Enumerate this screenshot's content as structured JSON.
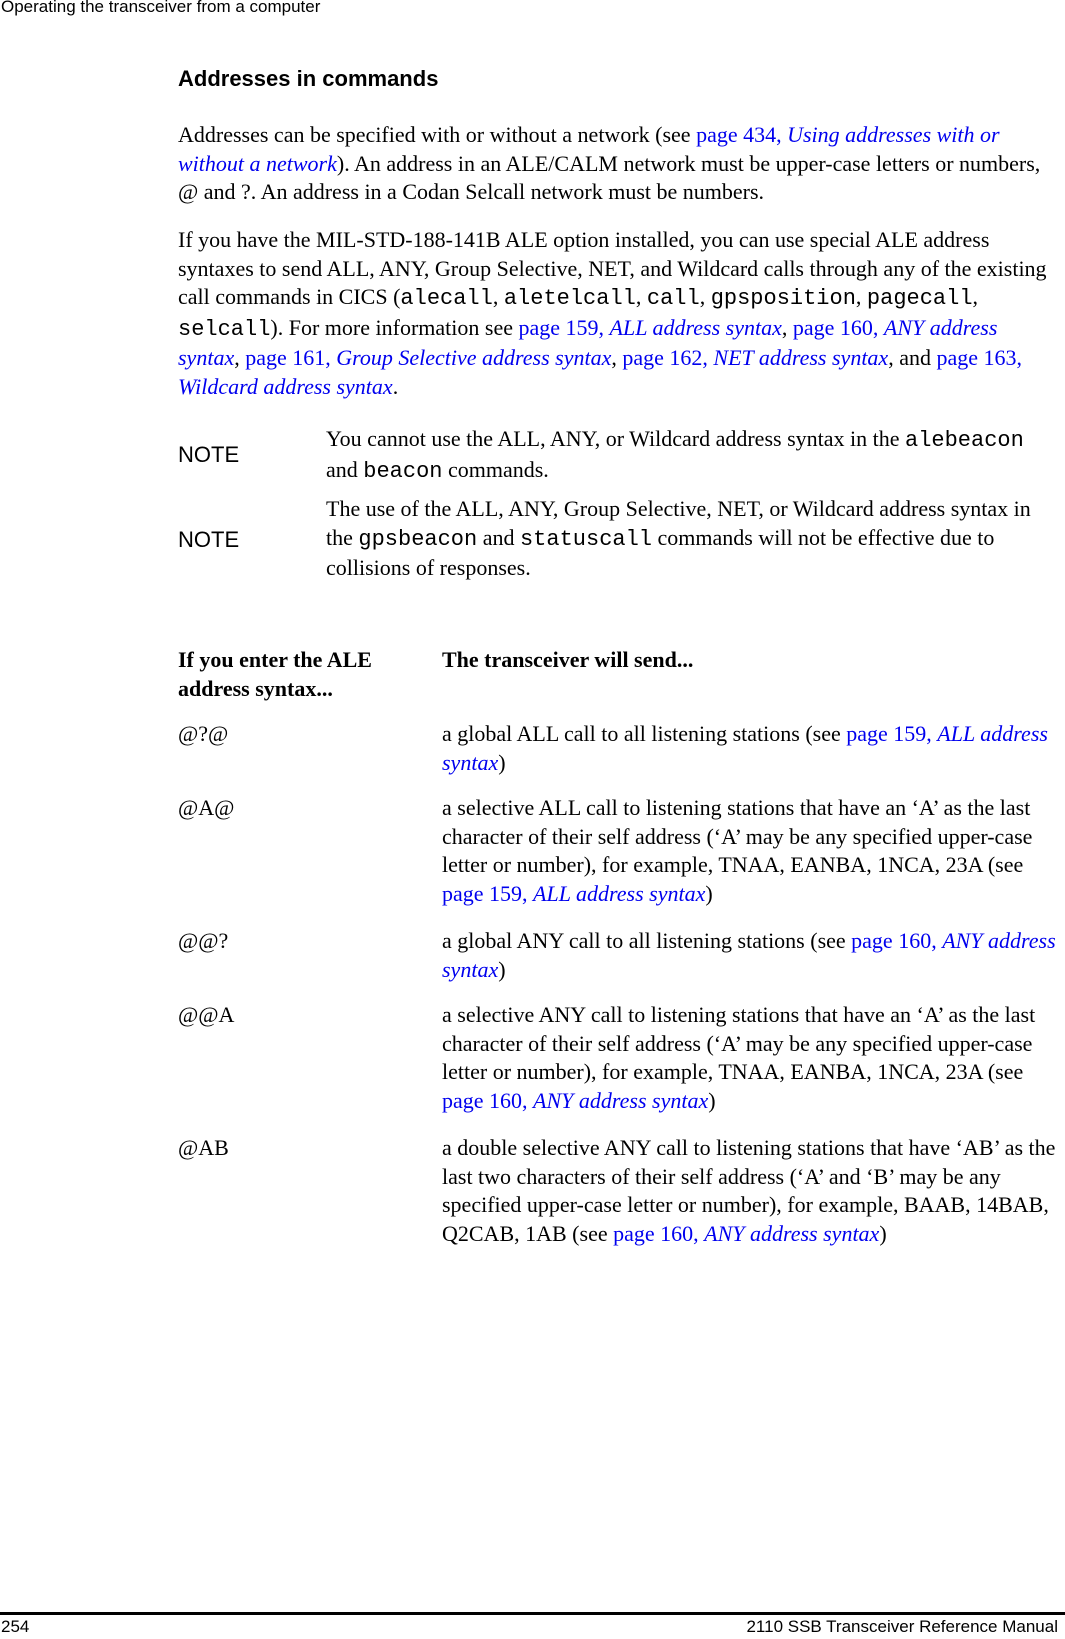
{
  "header": {
    "running_title": "Operating the transceiver from a computer"
  },
  "section": {
    "heading": "Addresses in commands"
  },
  "para1": {
    "t1": "Addresses can be specified with or without a network (see ",
    "link_page": "page 434, ",
    "link_title": "Using addresses with or without a network",
    "t2": "). An address in an ALE/CALM network must be upper-case letters or numbers, @ and ?. An address in a Codan Selcall network must be numbers."
  },
  "para2": {
    "t1": "If you have the MIL-STD-188-141B ALE option installed, you can use special ALE address syntaxes to send ALL, ANY, Group Selective, NET, and Wildcard calls through any of the existing call commands in CICS (",
    "cmds": [
      "alecall",
      "aletelcall",
      "call",
      "gpsposition",
      "pagecall",
      "selcall"
    ],
    "sep": ", ",
    "t2": "). For more information see ",
    "links": [
      {
        "page": "page 159, ",
        "title": "ALL address syntax"
      },
      {
        "page": "page 160, ",
        "title": "ANY address syntax"
      },
      {
        "page": "page 161, ",
        "title": "Group Selective address syntax"
      },
      {
        "page": "page 162, ",
        "title": "NET address syntax"
      },
      {
        "page": "page 163, ",
        "title": "Wildcard address syntax"
      }
    ],
    "and": ", and ",
    "end": "."
  },
  "notes": [
    {
      "label": "NOTE",
      "t1": "You cannot use the ALL, ANY, or Wildcard address syntax in the ",
      "cmd1": "alebeacon",
      "t2": " and ",
      "cmd2": "beacon",
      "t3": " commands."
    },
    {
      "label": "NOTE",
      "t1": "The use of the ALL, ANY, Group Selective, NET, or Wildcard address syntax in the ",
      "cmd1": "gpsbeacon",
      "t2": " and ",
      "cmd2": "statuscall",
      "t3": " commands will not be effective due to collisions of responses."
    }
  ],
  "table": {
    "headers": [
      "If you enter the ALE address syntax...",
      "The transceiver will send..."
    ],
    "rows": [
      {
        "syntax": "@?@",
        "desc": "a global ALL call to all listening stations (see ",
        "link_page": "page 159, ",
        "link_title": "ALL address syntax",
        "close": ")"
      },
      {
        "syntax": "@A@",
        "desc": "a selective ALL call to listening stations that have an ‘A’ as the last character of their self address (‘A’ may be any specified upper-case letter or number), for example, TNAA, EANBA, 1NCA, 23A (see ",
        "link_page": "page 159, ",
        "link_title": "ALL address syntax",
        "close": ")"
      },
      {
        "syntax": "@@?",
        "desc": "a global ANY call to all listening stations (see ",
        "link_page": "page 160, ",
        "link_title": "ANY address syntax",
        "close": ")"
      },
      {
        "syntax": "@@A",
        "desc": "a selective ANY call to listening stations that have an ‘A’ as the last character of their self address (‘A’ may be any specified upper-case letter or number), for example, TNAA, EANBA, 1NCA, 23A (see ",
        "link_page": "page 160, ",
        "link_title": "ANY address syntax",
        "close": ")"
      },
      {
        "syntax": "@AB",
        "desc": "a double selective ANY call to listening stations that have ‘AB’ as the last two characters of their self address (‘A’ and ‘B’ may be any specified upper-case letter or number), for example, BAAB, 14BAB, Q2CAB, 1AB (see ",
        "link_page": "page 160, ",
        "link_title": "ANY address syntax",
        "close": ")"
      }
    ]
  },
  "footer": {
    "page_number": "254",
    "manual_title": "2110 SSB Transceiver Reference Manual"
  },
  "colors": {
    "link": "#0000ee",
    "text": "#000000"
  }
}
